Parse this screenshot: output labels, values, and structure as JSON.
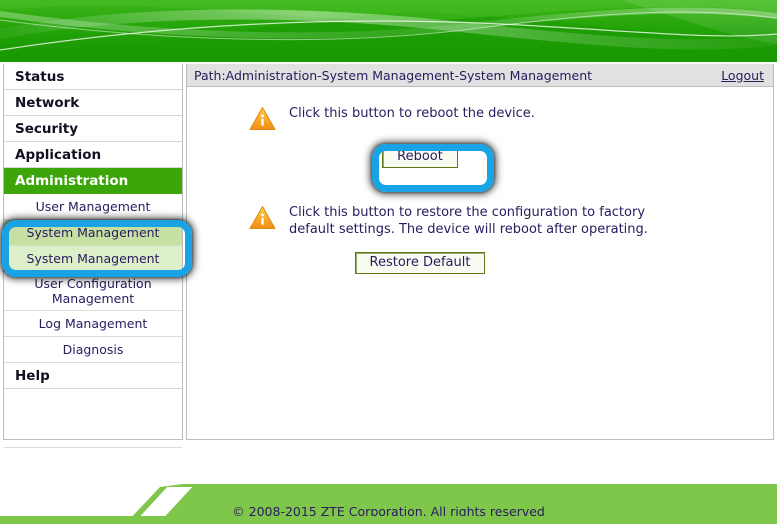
{
  "header": {
    "banner_color": "#2aa20a",
    "banner_highlight": "#8fd968"
  },
  "sidebar": {
    "top_items": [
      {
        "label": "Status",
        "active": false
      },
      {
        "label": "Network",
        "active": false
      },
      {
        "label": "Security",
        "active": false
      },
      {
        "label": "Application",
        "active": false
      },
      {
        "label": "Administration",
        "active": true
      }
    ],
    "sub_items": [
      {
        "label": "User Management",
        "state": "normal"
      },
      {
        "label": "System Management",
        "state": "selected-parent"
      },
      {
        "label": "System Management",
        "state": "selected-child"
      },
      {
        "label": "User Configuration Management",
        "state": "wrap"
      },
      {
        "label": "Log Management",
        "state": "normal"
      },
      {
        "label": "Diagnosis",
        "state": "normal"
      }
    ],
    "help_top_item": "Help",
    "help_button": {
      "icon": "question-circle-icon",
      "glyph": "?",
      "label": "Help"
    },
    "active_color": "#3ba50a",
    "selected_parent_color": "#c6e0a3",
    "selected_child_color": "#dcefc8"
  },
  "content": {
    "path_label": "Path:Administration-System Management-System Management",
    "logout_label": "Logout",
    "sections": [
      {
        "icon": "warning-triangle-info-icon",
        "text": "Click this button to reboot the device.",
        "button_label": "Reboot"
      },
      {
        "icon": "warning-triangle-info-icon",
        "text": "Click this button to restore the configuration to factory default settings. The device will reboot after operating.",
        "button_label": "Restore Default"
      }
    ]
  },
  "annotations": {
    "color": "#19a3e5",
    "reboot_highlight": "Reboot button highlight",
    "sidebar_highlight": "System Management menu highlight"
  },
  "footer": {
    "copyright": "© 2008-2015 ZTE Corporation. All rights reserved",
    "stripe_color": "#7ec74a"
  }
}
